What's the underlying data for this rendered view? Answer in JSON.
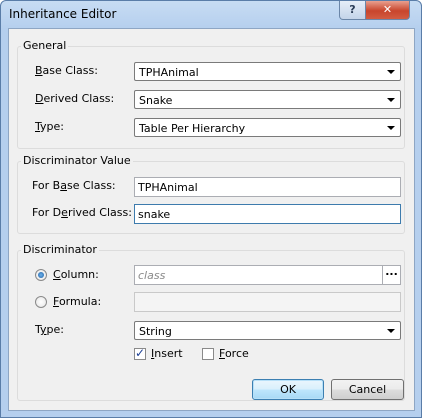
{
  "window": {
    "title": "Inheritance Editor",
    "help_glyph": "?",
    "close_glyph": "✕"
  },
  "general": {
    "title": "General",
    "base_class_label_u": "B",
    "base_class_label_rest": "ase Class:",
    "base_class_value": "TPHAnimal",
    "derived_class_label_u": "D",
    "derived_class_label_rest": "erived Class:",
    "derived_class_value": "Snake",
    "type_label_u": "T",
    "type_label_rest": "ype:",
    "type_value": "Table Per Hierarchy"
  },
  "discriminator_value": {
    "title": "Discriminator Value",
    "for_base_prefix": "For B",
    "for_base_u": "a",
    "for_base_rest": "se Class:",
    "for_base_value": "TPHAnimal",
    "for_derived_prefix": "For D",
    "for_derived_u": "e",
    "for_derived_rest": "rived Class:",
    "for_derived_value": "snake"
  },
  "discriminator": {
    "title": "Discriminator",
    "column_label_u": "C",
    "column_label_rest": "olumn:",
    "column_placeholder": "class",
    "column_selected": true,
    "ellipsis": "...",
    "formula_label_u": "F",
    "formula_label_rest": "ormula:",
    "formula_value": "",
    "type_label_prefix": "T",
    "type_label_u": "y",
    "type_label_rest": "pe:",
    "type_value": "String",
    "insert_label_u": "I",
    "insert_label_rest": "nsert",
    "insert_checked": true,
    "force_label_u": "F",
    "force_label_rest": "orce",
    "force_checked": false
  },
  "buttons": {
    "ok": "OK",
    "cancel": "Cancel"
  },
  "colors": {
    "accent": "#3c7fb1",
    "title_bar": "#b5cfee",
    "close_button": "#c8452c"
  }
}
